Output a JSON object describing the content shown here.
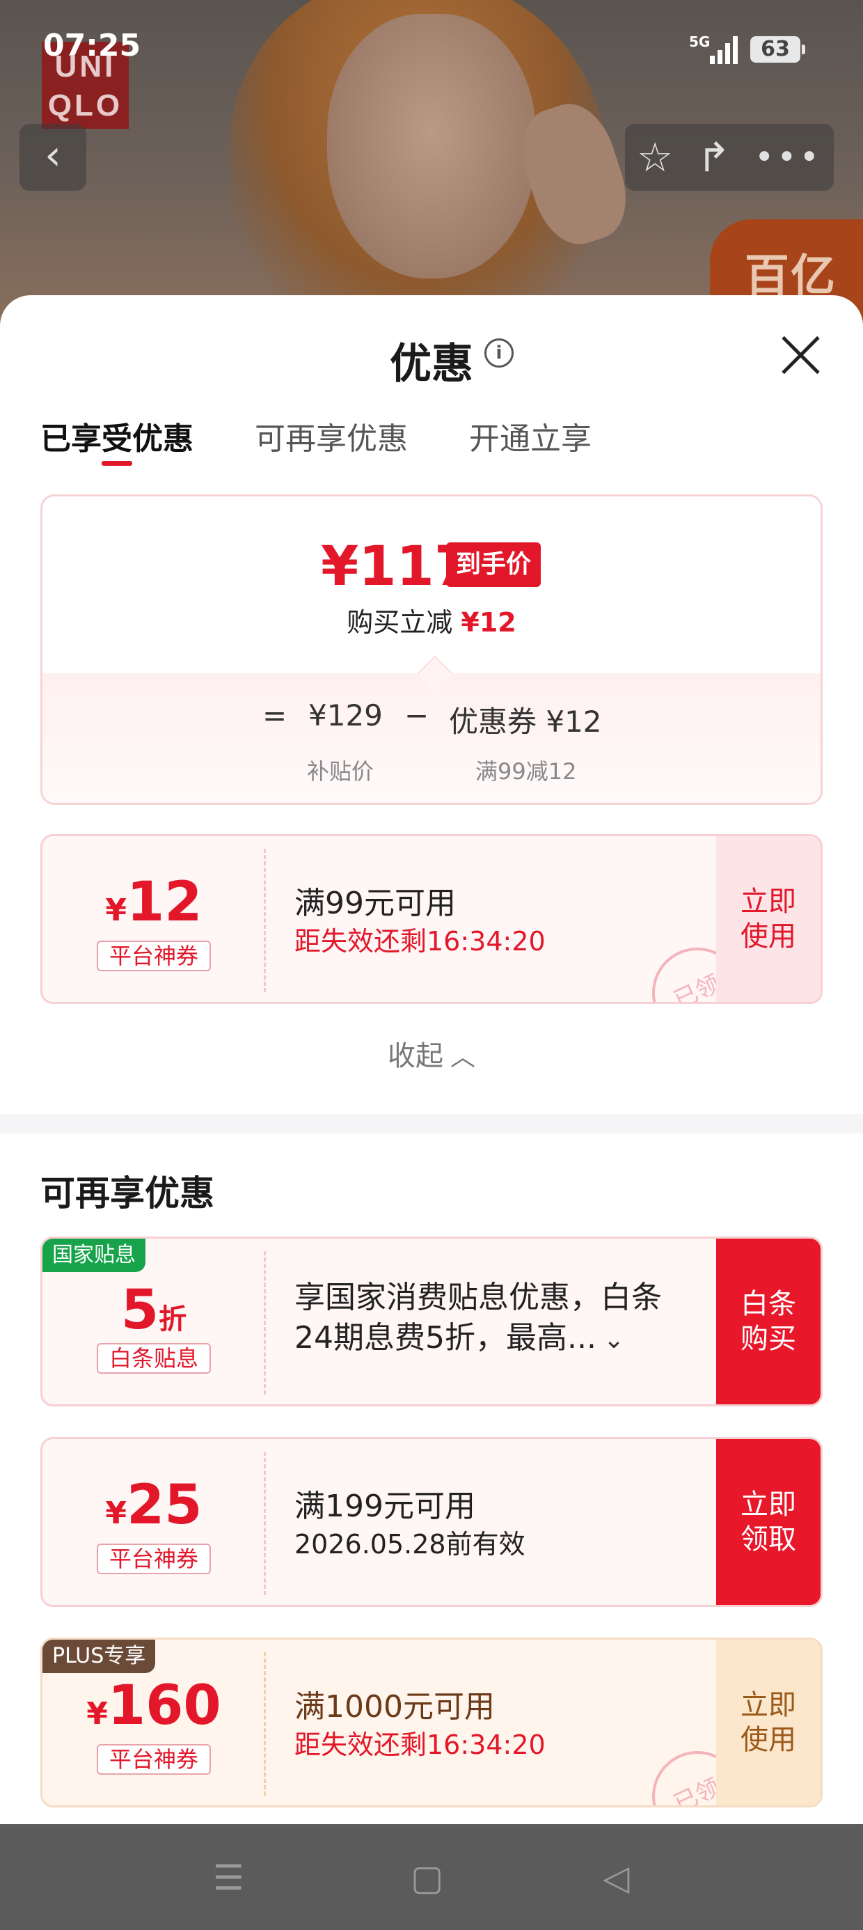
{
  "status_bar": {
    "time": "07:25",
    "network": "5G",
    "battery": "63"
  },
  "header": {
    "brand_logo_text": "UNI QLO",
    "promo_badge_text": "百亿"
  },
  "sheet": {
    "title": "优惠",
    "tabs": [
      {
        "label": "已享受优惠"
      },
      {
        "label": "可再享优惠"
      },
      {
        "label": "开通立享"
      }
    ]
  },
  "price_summary": {
    "final_price": "¥117",
    "final_price_tag": "到手价",
    "instant_cut_label": "购买立减",
    "instant_cut_value": "¥12",
    "equals": "=",
    "base_price": "¥129",
    "minus": "−",
    "coupon_label": "优惠券 ¥12",
    "base_price_sub": "补贴价",
    "coupon_sub": "满99减12"
  },
  "applied_coupon": {
    "currency": "¥",
    "amount": "12",
    "label": "平台神券",
    "title": "满99元可用",
    "expiry": "距失效还剩16:34:20",
    "action": "立即使用",
    "stamp": "已领"
  },
  "collapse_label": "收起",
  "more_section": {
    "title": "可再享优惠",
    "offers": [
      {
        "corner": "国家贴息",
        "amount": "5",
        "unit": "折",
        "label": "白条贴息",
        "description": "享国家消费贴息优惠，白条24期息费5折，最高...",
        "action": "白条购买"
      },
      {
        "currency": "¥",
        "amount": "25",
        "label": "平台神券",
        "title": "满199元可用",
        "validity": "2026.05.28前有效",
        "action": "立即领取"
      },
      {
        "corner": "PLUS专享",
        "currency": "¥",
        "amount": "160",
        "label": "平台神券",
        "title": "满1000元可用",
        "expiry": "距失效还剩16:34:20",
        "action": "立即使用",
        "stamp": "已领"
      }
    ]
  },
  "colors": {
    "accent_red": "#e3172a",
    "plus_gold": "#9a5a1a",
    "gov_green": "#16a34a",
    "plus_brown": "#6b4a38"
  }
}
